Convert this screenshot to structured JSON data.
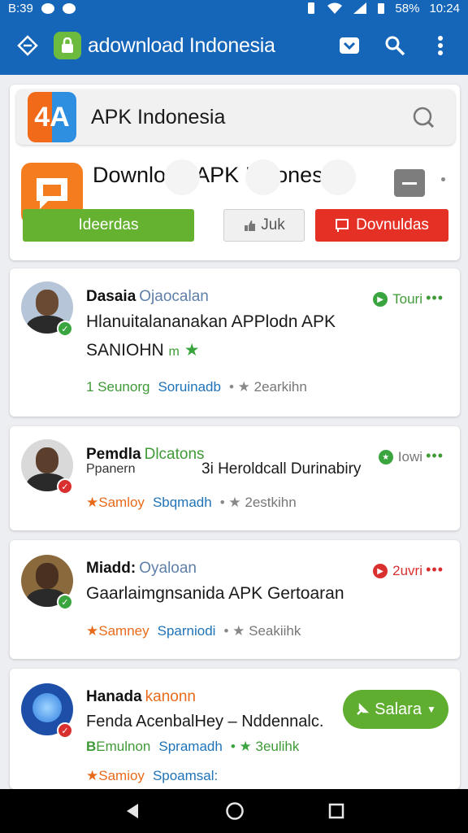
{
  "status": {
    "time_left": "B:39",
    "battery": "58%",
    "time_right": "10:24"
  },
  "appbar": {
    "title": "adownload Indonesia"
  },
  "header": {
    "search_text": "APK Indonesia",
    "logo_text": "4A",
    "app_title": "Download APK Indonesia",
    "btn_green": "Ideerdas",
    "btn_gray": "Juk",
    "btn_red": "Dovnuldas"
  },
  "cards": [
    {
      "name": "Dasaia",
      "sub": "Ojaocalan",
      "line1": "Hlanuitalananakan APPlodn APK",
      "line2": "SANIOHN",
      "line2_extra": "m",
      "tag": "Touri",
      "meta1": "1 Seunorg",
      "meta2": "Soruinadb",
      "meta3": "2earkihn"
    },
    {
      "name": "Pemdla",
      "sub": "Dlcatons",
      "line1a": "Ppanern",
      "line1b": "3i Heroldcall Durinabiry",
      "tag": "Iowi",
      "meta1": "Samloy",
      "meta2": "Sbqmadh",
      "meta3": "2estkihn"
    },
    {
      "name": "Miadd:",
      "sub": "Oyaloan",
      "line1": "Gaarlaimgnsanida APK Gertoaran",
      "tag": "2uvri",
      "meta1": "Samney",
      "meta2": "Sparniodi",
      "meta3": "Seakiihk"
    },
    {
      "name": "Hanada",
      "sub": "kanonn",
      "line1": "Fenda AcenbalHey – Nddennalc.",
      "meta1": "Emulnon",
      "meta2": "Spramadh",
      "meta3": "3eulihk",
      "meta4": "Samioy",
      "meta5": "Spoamsal:",
      "pill": "Salara"
    }
  ],
  "colors": {
    "brand_blue": "#1565b8",
    "green": "#64b230",
    "red": "#e53125",
    "orange": "#f47d20"
  }
}
